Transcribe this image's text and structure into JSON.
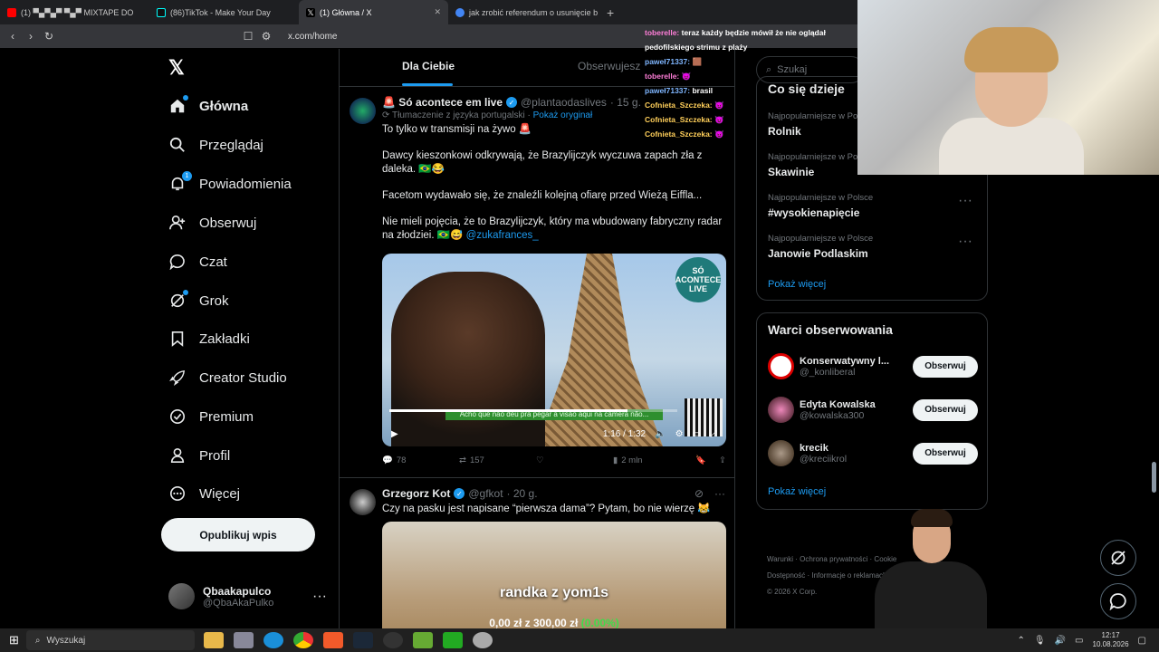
{
  "browser": {
    "tabs": [
      {
        "label": "(1) ▀▄▀▄▀ ▀▄▀ MIXTAPE DO",
        "color": "#ff0000"
      },
      {
        "label": "(86)TikTok - Make Your Day",
        "color": "#111111"
      },
      {
        "label": "(1) Główna / X",
        "color": "#ffffff"
      },
      {
        "label": "jak zrobić referendum o usunięcie bu",
        "color": "#4285f4"
      }
    ],
    "new_tab": "+",
    "url": "x.com/home"
  },
  "sidebar": {
    "logo": "𝕏",
    "items": [
      {
        "label": "Główna",
        "icon": "home-icon"
      },
      {
        "label": "Przeglądaj",
        "icon": "search-icon"
      },
      {
        "label": "Powiadomienia",
        "icon": "bell-icon",
        "badge": "1"
      },
      {
        "label": "Obserwuj",
        "icon": "add-person-icon"
      },
      {
        "label": "Czat",
        "icon": "chat-bubble-icon"
      },
      {
        "label": "Grok",
        "icon": "grok-icon"
      },
      {
        "label": "Zakładki",
        "icon": "bookmark-icon"
      },
      {
        "label": "Creator Studio",
        "icon": "rocket-icon"
      },
      {
        "label": "Premium",
        "icon": "verified-badge-icon"
      },
      {
        "label": "Profil",
        "icon": "person-icon"
      },
      {
        "label": "Więcej",
        "icon": "more-circle-icon"
      }
    ],
    "post_button": "Opublikuj wpis",
    "account": {
      "name": "Qbaakapulco",
      "handle": "@QbaAkaPulko",
      "more": "···"
    }
  },
  "timeline": {
    "tabs": [
      "Dla Ciebie",
      "Obserwujesz"
    ],
    "posts": [
      {
        "author": "🚨 Só acontece em live",
        "handle": "@plantaodaslives",
        "time": "· 15 g.",
        "translation": "Tłumaczenie z języka portugalski",
        "show_original": "Pokaż oryginał",
        "text": [
          "To tylko w transmisji na żywo 🚨",
          "Dawcy kieszonkowi odkrywają, że Brazylijczyk wyczuwa zapach zła z daleka. 🇧🇷😂",
          "Facetom wydawało się, że znaleźli kolejną ofiarę przed Wieżą Eiffla...",
          "Nie mieli pojęcia, że to Brazylijczyk, który ma wbudowany fabryczny radar na złodziei. 🇧🇷😅"
        ],
        "mention": "@zukafrances_",
        "video": {
          "badge": "SÓ ACONTECE LIVE",
          "subtitle": "Acho que não deu pra pegar a visão aqui na câmera não...",
          "time": "1:16 / 1:32",
          "progress": 0.826
        },
        "stats": {
          "replies": "78",
          "reposts": "157",
          "likes": "",
          "views": "2 mln"
        }
      },
      {
        "author": "Grzegorz Kot",
        "handle": "@gfkot",
        "time": "· 20 g.",
        "text": "Czy na pasku jest napisane “pierwsza dama”? Pytam, bo nie wierzę 😹",
        "media_title": "randka z yom1s",
        "media_price_a": "0,00 zł",
        "media_price_sep": "z",
        "media_price_b": "300,00 zł",
        "media_pct": "(0.00%)"
      }
    ]
  },
  "right": {
    "search_placeholder": "Szukaj",
    "trends_title": "Co się dzieje",
    "trends": [
      {
        "meta": "Najpopularniejsze w Polsce",
        "topic": "Rolnik"
      },
      {
        "meta": "Najpopularniejsze w Polsce",
        "topic": "Skawinie"
      },
      {
        "meta": "Najpopularniejsze w Polsce",
        "topic": "#wysokienapięcie"
      },
      {
        "meta": "Najpopularniejsze w Polsce",
        "topic": "Janowie Podlaskim"
      }
    ],
    "show_more": "Pokaż więcej",
    "follow_title": "Warci obserwowania",
    "follow": [
      {
        "name": "Konserwatywny l...",
        "handle": "@_konliberal",
        "button": "Obserwuj"
      },
      {
        "name": "Edyta Kowalska",
        "handle": "@kowalska300",
        "button": "Obserwuj"
      },
      {
        "name": "krecik",
        "handle": "@kreciikrol",
        "button": "Obserwuj"
      }
    ],
    "footer": [
      "Warunki",
      "Ochrona prywatności",
      "Cookie",
      "Dostępność",
      "Informacje o reklamach",
      "© 2026 X Corp."
    ]
  },
  "chat": [
    {
      "user": "toberelle:",
      "msg": "teraz każdy będzie mówił że nie oglądał pedofilskiego strimu z plaży",
      "cls": "u1"
    },
    {
      "user": "paweł71337:",
      "msg": "🟫",
      "cls": "u2"
    },
    {
      "user": "toberelle:",
      "msg": "😈",
      "cls": "u1"
    },
    {
      "user": "paweł71337:",
      "msg": "brasil",
      "cls": "u2"
    },
    {
      "user": "Cofnieta_Szczeka:",
      "msg": "😈",
      "cls": "u3"
    },
    {
      "user": "Cofnieta_Szczeka:",
      "msg": "😈",
      "cls": "u3"
    },
    {
      "user": "Cofnieta_Szczeka:",
      "msg": "😈",
      "cls": "u3"
    }
  ],
  "taskbar": {
    "search": "Wyszukaj",
    "time": "12:17",
    "date": "10.08.2026"
  },
  "colors": {
    "accent": "#1d9bf0",
    "background": "#000000",
    "border": "#2f3336",
    "muted": "#71767b"
  }
}
